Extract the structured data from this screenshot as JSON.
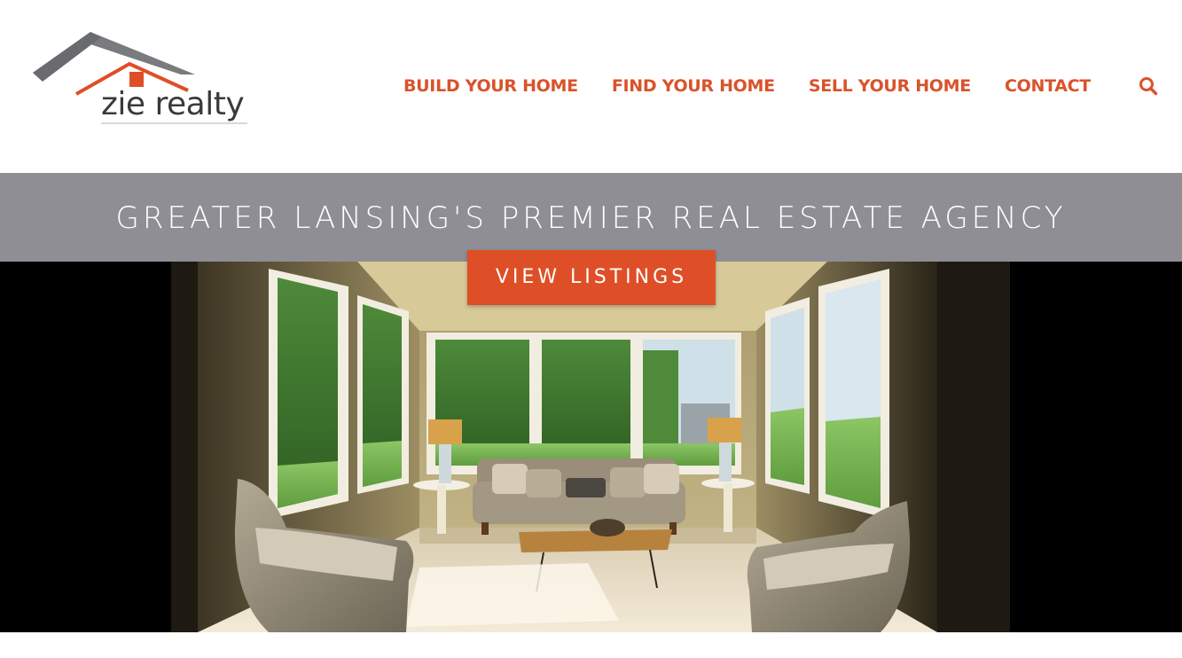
{
  "brand": {
    "name": "zie realty",
    "logo_roof_color": "#7a7b7e",
    "logo_accent_color": "#de4f27"
  },
  "nav": {
    "items": [
      {
        "label": "BUILD YOUR HOME"
      },
      {
        "label": "FIND YOUR HOME"
      },
      {
        "label": "SELL YOUR HOME"
      },
      {
        "label": "CONTACT"
      }
    ],
    "search_icon": "search-icon",
    "link_color": "#d9532b"
  },
  "hero": {
    "tagline": "GREATER LANSING'S PREMIER REAL ESTATE AGENCY",
    "cta_label": "VIEW LISTINGS",
    "band_color": "#8e8e94",
    "cta_color": "#de4f27",
    "image_subject": "sunroom-living-room-photo"
  }
}
